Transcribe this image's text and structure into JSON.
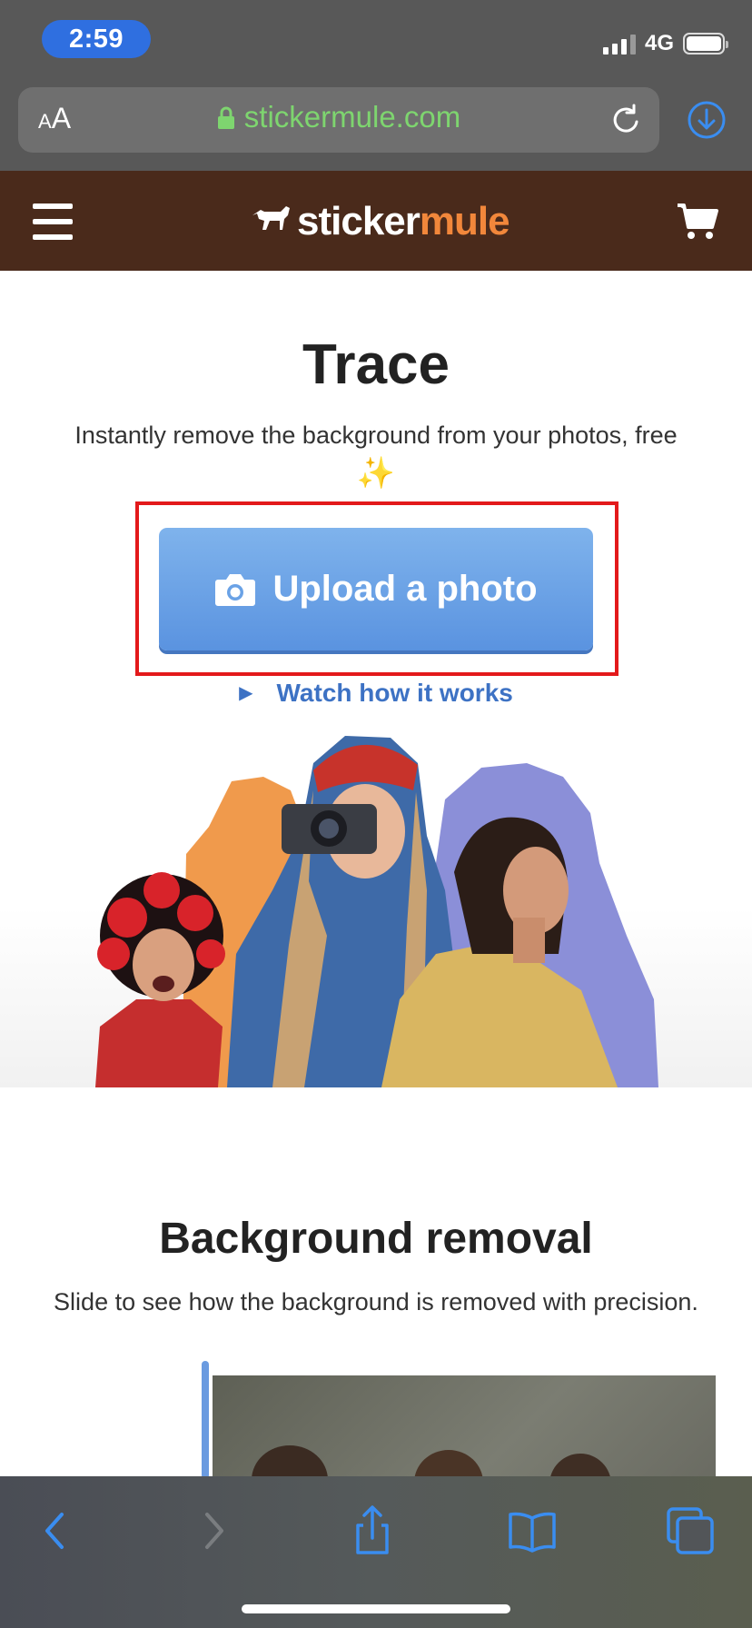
{
  "status_bar": {
    "time": "2:59",
    "network": "4G",
    "battery_level": 1.0,
    "signal_bars": 3
  },
  "browser": {
    "text_size_label_small": "A",
    "text_size_label_large": "A",
    "url": "stickermule.com",
    "icons": [
      "lock-icon",
      "reload-icon",
      "download-icon"
    ],
    "accent_color": "#7ed56f"
  },
  "site_header": {
    "logo_part1": "sticker",
    "logo_part2": "mule",
    "logo_color_part2": "#f2873b",
    "background_color": "#4a2a1b",
    "icons": [
      "hamburger-menu-icon",
      "horse-logo-icon",
      "cart-icon"
    ]
  },
  "hero": {
    "title": "Trace",
    "subtitle": "Instantly remove the background from your photos, free",
    "sparkle": "✨",
    "upload_button_label": "Upload a photo",
    "watch_link_label": "Watch how it works",
    "button_color": "#6aa2e6",
    "highlight_color": "#e3191b"
  },
  "background_removal": {
    "title": "Background removal",
    "subtitle": "Slide to see how the background is removed with precision."
  },
  "bottom_toolbar": {
    "icons": [
      "back-icon",
      "forward-icon",
      "share-icon",
      "bookmarks-icon",
      "tabs-icon"
    ]
  }
}
